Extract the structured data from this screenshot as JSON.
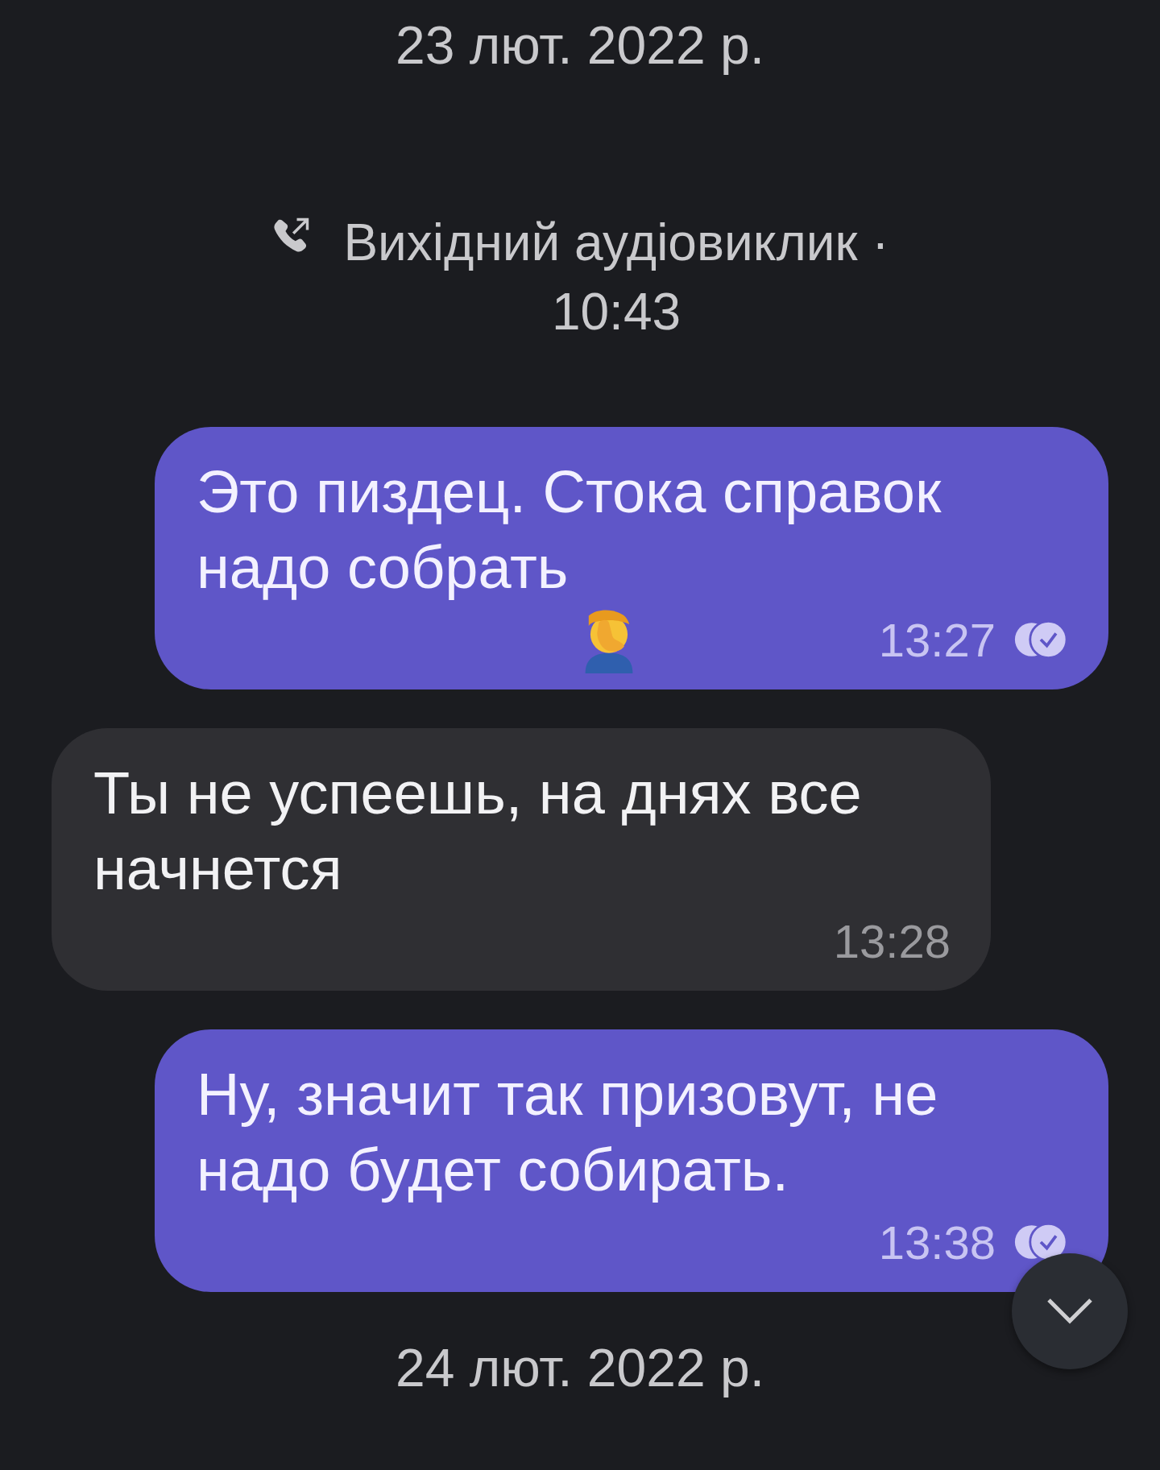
{
  "dates": [
    "23 лют. 2022 р.",
    "24 лют. 2022 р."
  ],
  "call": {
    "text": "Вихідний аудіовиклик ·",
    "time": "10:43"
  },
  "messages": [
    {
      "kind": "outgoing",
      "text": "Это пиздец. Стока справок надо собрать",
      "emoji": true,
      "time": "13:27",
      "read": true
    },
    {
      "kind": "incoming",
      "text": "Ты не успеешь, на днях все начнется",
      "emoji": false,
      "time": "13:28",
      "read": false
    },
    {
      "kind": "outgoing",
      "text": "Ну, значит так призовут, не надо будет собирать.",
      "emoji": false,
      "time": "13:38",
      "read": true
    }
  ]
}
